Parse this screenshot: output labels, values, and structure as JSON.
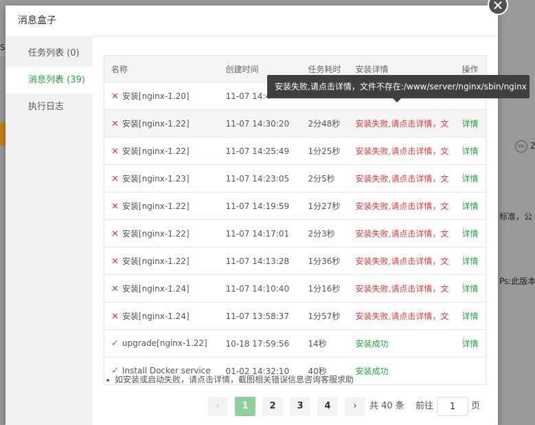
{
  "background": {
    "fragments": [
      "S",
      "标准，公",
      "Ps:此版本",
      "2"
    ],
    "ssl_label": "SSL"
  },
  "modal": {
    "title": "消息盒子",
    "close_glyph": "✕"
  },
  "sidebar": {
    "items": [
      {
        "label": "任务列表 (0)",
        "active": false
      },
      {
        "label": "消息列表 (39)",
        "active": true
      },
      {
        "label": "执行日志",
        "active": false
      }
    ]
  },
  "table": {
    "headers": [
      "名称",
      "创建时间",
      "任务耗时",
      "安装详情",
      "操作"
    ],
    "rows": [
      {
        "status": "fail",
        "name": "安装[nginx-1.20]",
        "time": "11-07 14:4",
        "duration": "",
        "detail": "",
        "op": ""
      },
      {
        "status": "fail",
        "name": "安装[nginx-1.22]",
        "time": "11-07 14:30:20",
        "duration": "2分48秒",
        "detail": "安装失败,请点击详情，文",
        "op": "详情"
      },
      {
        "status": "fail",
        "name": "安装[nginx-1.22]",
        "time": "11-07 14:25:49",
        "duration": "1分25秒",
        "detail": "安装失败,请点击详情，文",
        "op": "详情"
      },
      {
        "status": "fail",
        "name": "安装[nginx-1.23]",
        "time": "11-07 14:23:05",
        "duration": "2分5秒",
        "detail": "安装失败,请点击详情，文",
        "op": "详情"
      },
      {
        "status": "fail",
        "name": "安装[nginx-1.22]",
        "time": "11-07 14:19:59",
        "duration": "1分27秒",
        "detail": "安装失败,请点击详情，文",
        "op": "详情"
      },
      {
        "status": "fail",
        "name": "安装[nginx-1.22]",
        "time": "11-07 14:17:01",
        "duration": "2分3秒",
        "detail": "安装失败,请点击详情，文",
        "op": "详情"
      },
      {
        "status": "fail",
        "name": "安装[nginx-1.22]",
        "time": "11-07 14:13:28",
        "duration": "1分36秒",
        "detail": "安装失败,请点击详情，文",
        "op": "详情"
      },
      {
        "status": "fail",
        "name": "安装[nginx-1.24]",
        "time": "11-07 14:10:40",
        "duration": "1分16秒",
        "detail": "安装失败,请点击详情，文",
        "op": "详情"
      },
      {
        "status": "fail",
        "name": "安装[nginx-1.24]",
        "time": "11-07 13:58:37",
        "duration": "1分57秒",
        "detail": "安装失败,请点击详情，文",
        "op": "详情"
      },
      {
        "status": "ok",
        "name": "upgrade[nginx-1.22]",
        "time": "10-18 17:59:56",
        "duration": "14秒",
        "detail": "安装成功",
        "op": "详情"
      },
      {
        "status": "ok",
        "name": "Install Docker service",
        "time": "01-02 14:32:10",
        "duration": "40秒",
        "detail": "安装成功",
        "op": ""
      }
    ]
  },
  "tooltip": {
    "text": "安装失败,请点击详情，文件不存在:/www/server/nginx/sbin/nginx"
  },
  "note": "如安装或启动失败，请点击详情，截图相关错误信息咨询客服求助",
  "pagination": {
    "prev": "‹",
    "pages": [
      "1",
      "2",
      "3",
      "4"
    ],
    "current": "1",
    "next": "›",
    "total": "共 40 条",
    "goto_label": "前往",
    "goto_value": "1",
    "page_suffix": "页"
  },
  "colors": {
    "accent": "#20a53a",
    "error": "#e0393a",
    "tooltip_bg": "#3f3f3f"
  }
}
